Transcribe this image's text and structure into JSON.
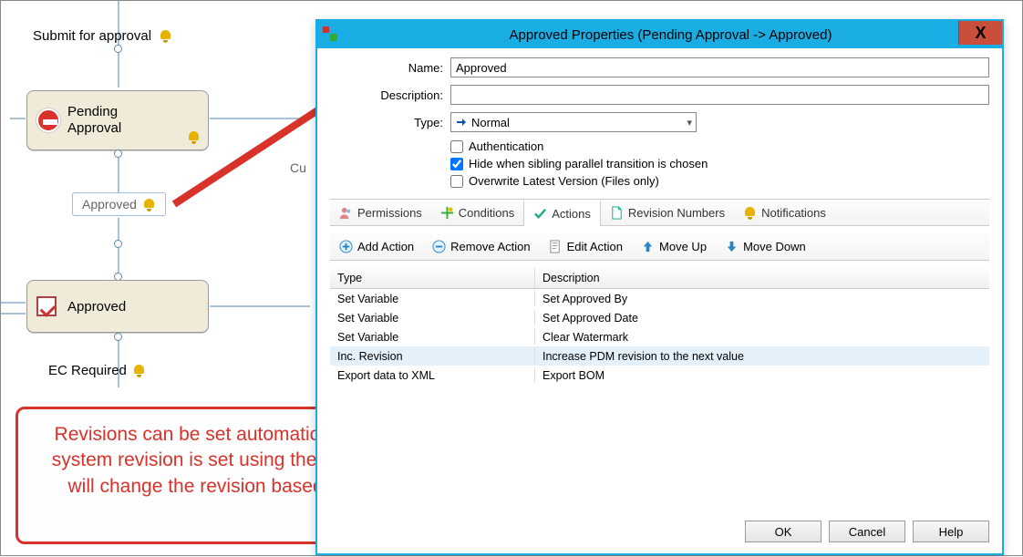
{
  "workflow": {
    "submit_label": "Submit for approval",
    "pending_label": "Pending\nApproval",
    "approved_trans_label": "Approved",
    "approved_state_label": "Approved",
    "ec_label": "EC Required",
    "cut_label": "Cu"
  },
  "dialog": {
    "title": "Approved Properties (Pending Approval -> Approved)",
    "close_label": "X",
    "name_lbl": "Name:",
    "name_val": "Approved",
    "desc_lbl": "Description:",
    "desc_val": "",
    "type_lbl": "Type:",
    "type_val": "Normal",
    "auth_lbl": "Authentication",
    "hide_lbl": "Hide when sibling parallel transition is chosen",
    "overwrite_lbl": "Overwrite Latest Version (Files only)",
    "tabs": {
      "permissions": "Permissions",
      "conditions": "Conditions",
      "actions": "Actions",
      "revnums": "Revision Numbers",
      "notifications": "Notifications"
    },
    "toolbar": {
      "add": "Add Action",
      "remove": "Remove Action",
      "edit": "Edit Action",
      "moveup": "Move Up",
      "movedown": "Move Down"
    },
    "table": {
      "col_type": "Type",
      "col_desc": "Description",
      "rows": [
        {
          "type": "Set Variable",
          "desc": "Set Approved By"
        },
        {
          "type": "Set Variable",
          "desc": "Set Approved Date"
        },
        {
          "type": "Set Variable",
          "desc": "Clear Watermark"
        },
        {
          "type": "Inc. Revision",
          "desc": "Increase PDM revision to the next value"
        },
        {
          "type": "Export data to XML",
          "desc": "Export BOM"
        }
      ]
    },
    "buttons": {
      "ok": "OK",
      "cancel": "Cancel",
      "help": "Help"
    }
  },
  "callout": {
    "text": "Revisions can be set automatically during a workflow transition. The system revision is set using the \"Inc. Revision\" transition action. This will change the revision based on the increment rule in the target state."
  }
}
